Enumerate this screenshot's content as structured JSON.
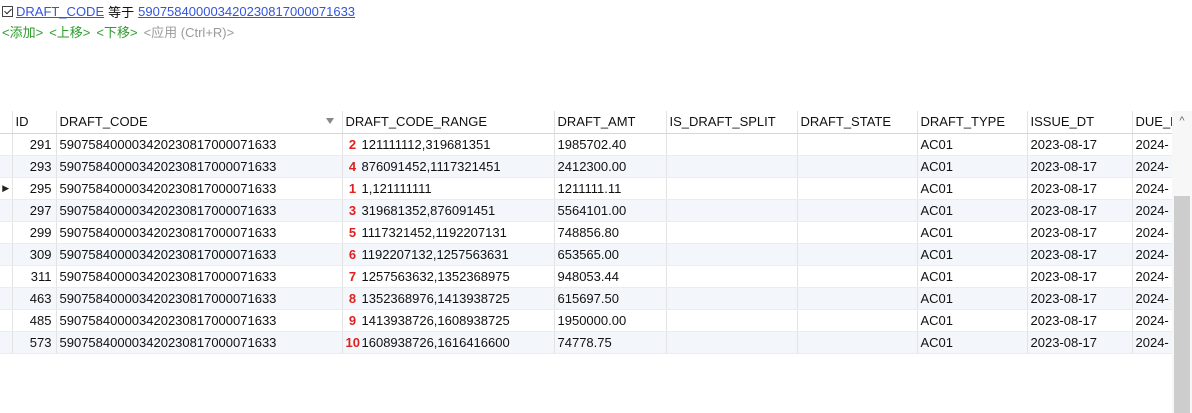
{
  "filter": {
    "field": "DRAFT_CODE",
    "operator": "等于",
    "value": "590758400003420230817000071633"
  },
  "actions": {
    "add": "<添加>",
    "up": "<上移>",
    "down": "<下移>",
    "apply": "<应用 (Ctrl+R)>"
  },
  "columns": [
    "ID",
    "DRAFT_CODE",
    "DRAFT_CODE_RANGE",
    "DRAFT_AMT",
    "IS_DRAFT_SPLIT",
    "DRAFT_STATE",
    "DRAFT_TYPE",
    "ISSUE_DT",
    "DUE_D"
  ],
  "rows": [
    {
      "id": "291",
      "code": "590758400003420230817000071633",
      "mark": "2",
      "range": "121111112,319681351",
      "amt": "1985702.40",
      "split": "",
      "state": "",
      "type": "AC01",
      "issue": "2023-08-17",
      "due": "2024-"
    },
    {
      "id": "293",
      "code": "590758400003420230817000071633",
      "mark": "4",
      "range": "876091452,1117321451",
      "amt": "2412300.00",
      "split": "",
      "state": "",
      "type": "AC01",
      "issue": "2023-08-17",
      "due": "2024-"
    },
    {
      "id": "295",
      "code": "590758400003420230817000071633",
      "mark": "1",
      "range": "1,121111111",
      "amt": "1211111.11",
      "split": "",
      "state": "",
      "type": "AC01",
      "issue": "2023-08-17",
      "due": "2024-"
    },
    {
      "id": "297",
      "code": "590758400003420230817000071633",
      "mark": "3",
      "range": "319681352,876091451",
      "amt": "5564101.00",
      "split": "",
      "state": "",
      "type": "AC01",
      "issue": "2023-08-17",
      "due": "2024-"
    },
    {
      "id": "299",
      "code": "590758400003420230817000071633",
      "mark": "5",
      "range": "1117321452,1192207131",
      "amt": "748856.80",
      "split": "",
      "state": "",
      "type": "AC01",
      "issue": "2023-08-17",
      "due": "2024-"
    },
    {
      "id": "309",
      "code": "590758400003420230817000071633",
      "mark": "6",
      "range": "1192207132,1257563631",
      "amt": "653565.00",
      "split": "",
      "state": "",
      "type": "AC01",
      "issue": "2023-08-17",
      "due": "2024-"
    },
    {
      "id": "311",
      "code": "590758400003420230817000071633",
      "mark": "7",
      "range": "1257563632,1352368975",
      "amt": "948053.44",
      "split": "",
      "state": "",
      "type": "AC01",
      "issue": "2023-08-17",
      "due": "2024-"
    },
    {
      "id": "463",
      "code": "590758400003420230817000071633",
      "mark": "8",
      "range": "1352368976,1413938725",
      "amt": "615697.50",
      "split": "",
      "state": "",
      "type": "AC01",
      "issue": "2023-08-17",
      "due": "2024-"
    },
    {
      "id": "485",
      "code": "590758400003420230817000071633",
      "mark": "9",
      "range": "1413938726,1608938725",
      "amt": "1950000.00",
      "split": "",
      "state": "",
      "type": "AC01",
      "issue": "2023-08-17",
      "due": "2024-"
    },
    {
      "id": "573",
      "code": "590758400003420230817000071633",
      "mark": "10",
      "range": "1608938726,1616416600",
      "amt": "74778.75",
      "split": "",
      "state": "",
      "type": "AC01",
      "issue": "2023-08-17",
      "due": "2024-"
    }
  ],
  "selected_row_index": 2,
  "colors": {
    "link": "#3355dd",
    "action": "#2a9d2a",
    "annotation": "#e01f1f",
    "alt_row": "#f3f7fc"
  },
  "icons": {
    "row_pointer": "triangle-right-icon",
    "filter": "filter-icon",
    "scroll_up": "chevron-up-icon"
  }
}
